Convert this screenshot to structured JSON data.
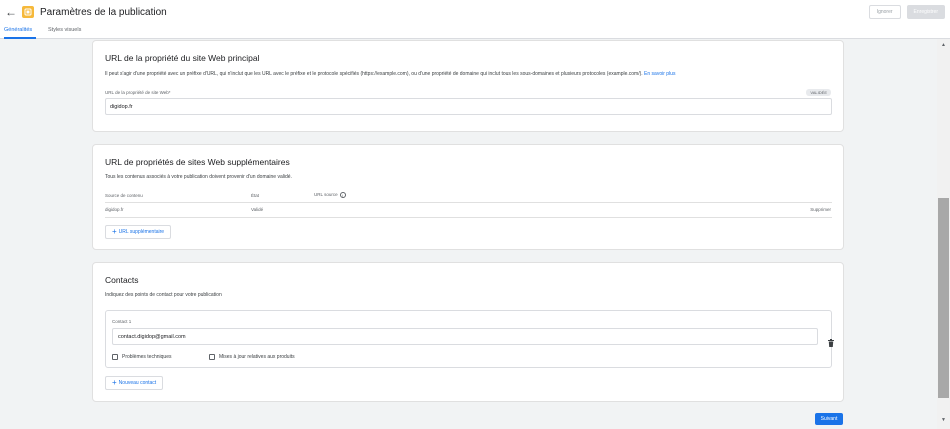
{
  "header": {
    "back_icon": "arrow-left-icon",
    "logo_color": "#f6b93b",
    "title": "Paramètres de la publication",
    "cancel_label": "Ignorer",
    "save_label": "Enregistrer"
  },
  "tabs": [
    {
      "label": "Généralités",
      "active": true
    },
    {
      "label": "Styles visuels",
      "active": false
    }
  ],
  "primary_site": {
    "title": "URL de la propriété du site Web principal",
    "description": "Il peut s'agir d'une propriété avec un préfixe d'URL, qui n'inclut que les URL avec le préfixe et le protocole spécifiés (https://example.com), ou d'une propriété de domaine qui inclut tous les sous-domaines et plusieurs protocoles (example.com/).",
    "learn_more": "En savoir plus",
    "field_label": "URL de la propriété de site Web*",
    "badge": "VALIDÉE",
    "value": "digidop.fr"
  },
  "additional_sites": {
    "title": "URL de propriétés de sites Web supplémentaires",
    "description": "Tous les contenus associés à votre publication doivent provenir d'un domaine validé.",
    "columns": [
      "Source de contenu",
      "État",
      "URL source"
    ],
    "rows": [
      {
        "source": "digidop.fr",
        "state": "Validé",
        "action": "Supprimer"
      }
    ],
    "add_button": "URL supplémentaire"
  },
  "contacts": {
    "title": "Contacts",
    "description": "Indiquez des points de contact pour votre publication",
    "contact_label": "Contact 1",
    "email": "contact.digidop@gmail.com",
    "checkbox_1": "Problèmes techniques",
    "checkbox_2": "Mises à jour relatives aux produits",
    "add_button": "Nouveau contact"
  },
  "footer": {
    "next_label": "Suivant"
  },
  "colors": {
    "accent": "#1a73e8",
    "background": "#f1f3f4"
  }
}
